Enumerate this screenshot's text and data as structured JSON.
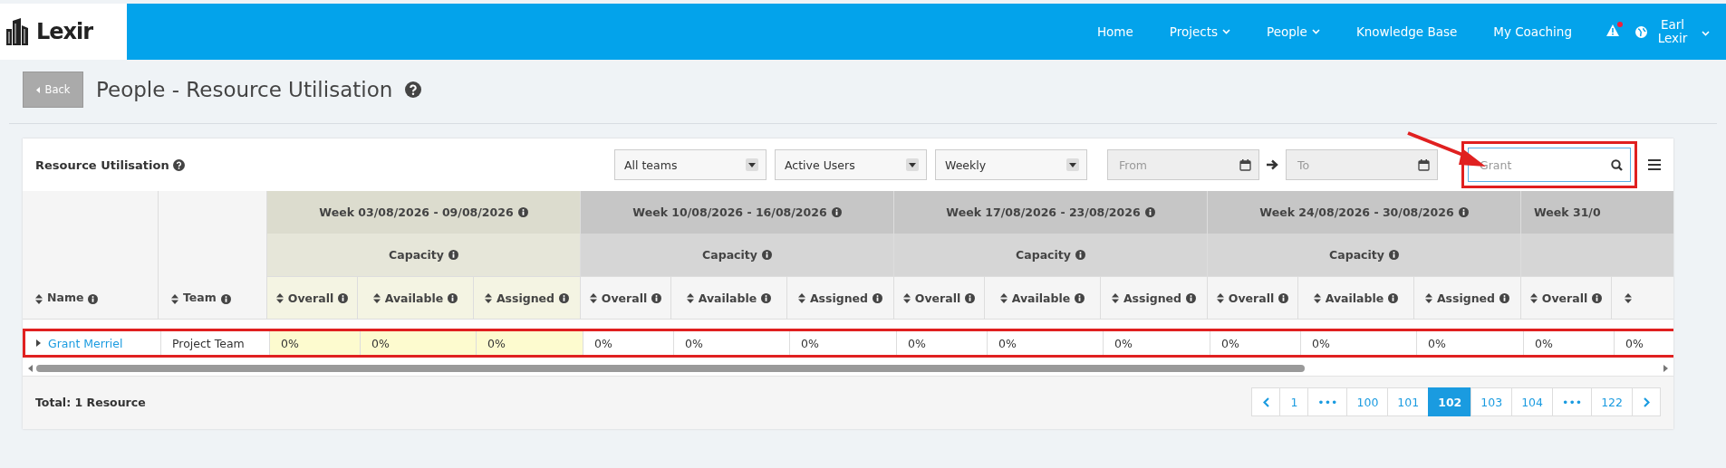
{
  "header": {
    "logo": "Lexir",
    "nav": [
      {
        "label": "Home",
        "dropdown": false
      },
      {
        "label": "Projects",
        "dropdown": true
      },
      {
        "label": "People",
        "dropdown": true
      },
      {
        "label": "Knowledge Base",
        "dropdown": false
      },
      {
        "label": "My Coaching",
        "dropdown": false
      }
    ],
    "alert_unread": true,
    "user": "Earl Lexir"
  },
  "page": {
    "back": "Back",
    "title": "People - Resource Utilisation"
  },
  "panel": {
    "title": "Resource Utilisation",
    "filters": [
      {
        "value": "All teams"
      },
      {
        "value": "Active Users"
      },
      {
        "value": "Weekly"
      }
    ],
    "from": {
      "placeholder": "From"
    },
    "to": {
      "placeholder": "To"
    },
    "search": {
      "placeholder": "Grant"
    }
  },
  "table": {
    "name_header": "Name",
    "team_header": "Team",
    "weeks": [
      {
        "label": "Week 03/08/2026 - 09/08/2026",
        "current": true,
        "group": "Capacity",
        "columns": [
          "Overall",
          "Available",
          "Assigned"
        ]
      },
      {
        "label": "Week 10/08/2026 - 16/08/2026",
        "current": false,
        "group": "Capacity",
        "columns": [
          "Overall",
          "Available",
          "Assigned"
        ]
      },
      {
        "label": "Week 17/08/2026 - 23/08/2026",
        "current": false,
        "group": "Capacity",
        "columns": [
          "Overall",
          "Available",
          "Assigned"
        ]
      },
      {
        "label": "Week 24/08/2026 - 30/08/2026",
        "current": false,
        "group": "Capacity",
        "columns": [
          "Overall",
          "Available",
          "Assigned"
        ]
      },
      {
        "label": "Week 31/0",
        "current": false,
        "columns": [
          "Overall",
          null
        ]
      }
    ],
    "rows": [
      {
        "name": "Grant Merriel",
        "team": "Project Team",
        "values": [
          "0%",
          "0%",
          "0%",
          "0%",
          "0%",
          "0%",
          "0%",
          "0%",
          "0%",
          "0%",
          "0%",
          "0%",
          "0%",
          "0%"
        ]
      }
    ]
  },
  "footer": {
    "total": "Total: 1 Resource",
    "pages": [
      {
        "label": "1",
        "selected": false
      },
      {
        "label": "•••",
        "selected": false
      },
      {
        "label": "100",
        "selected": false
      },
      {
        "label": "101",
        "selected": false
      },
      {
        "label": "102",
        "selected": true
      },
      {
        "label": "103",
        "selected": false
      },
      {
        "label": "104",
        "selected": false
      },
      {
        "label": "•••",
        "selected": false
      },
      {
        "label": "122",
        "selected": false
      }
    ]
  }
}
